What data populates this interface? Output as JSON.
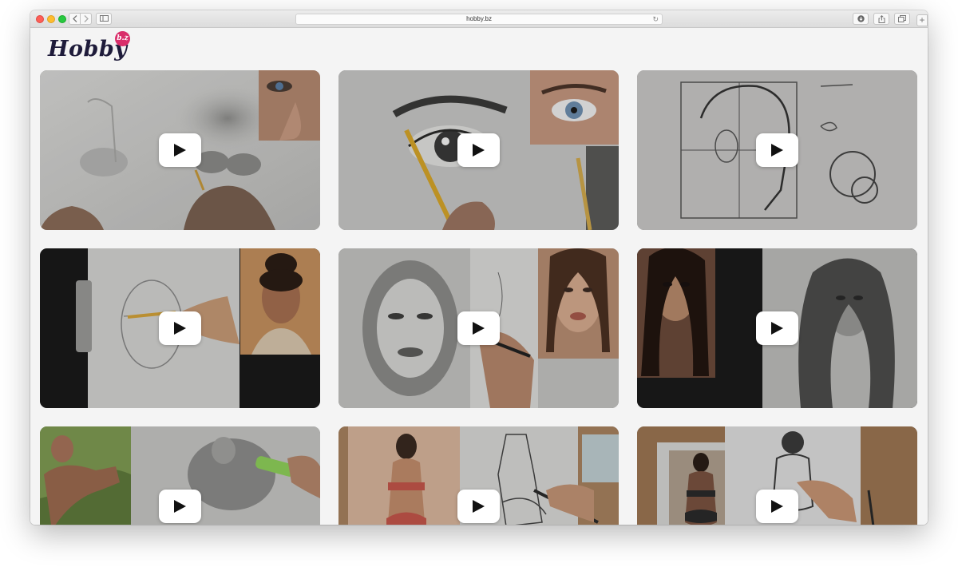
{
  "browser": {
    "url": "hobby.bz",
    "new_tab_symbol": "+"
  },
  "logo": {
    "word": "Hobby",
    "badge": "b.z"
  },
  "colors": {
    "brand_dark": "#1e1b3a",
    "brand_accent": "#d92e6a",
    "page_background": "#f4f4f4"
  },
  "videos": [
    {
      "icon": "play-icon"
    },
    {
      "icon": "play-icon"
    },
    {
      "icon": "play-icon"
    },
    {
      "icon": "play-icon"
    },
    {
      "icon": "play-icon"
    },
    {
      "icon": "play-icon"
    },
    {
      "icon": "play-icon"
    },
    {
      "icon": "play-icon"
    },
    {
      "icon": "play-icon"
    }
  ]
}
